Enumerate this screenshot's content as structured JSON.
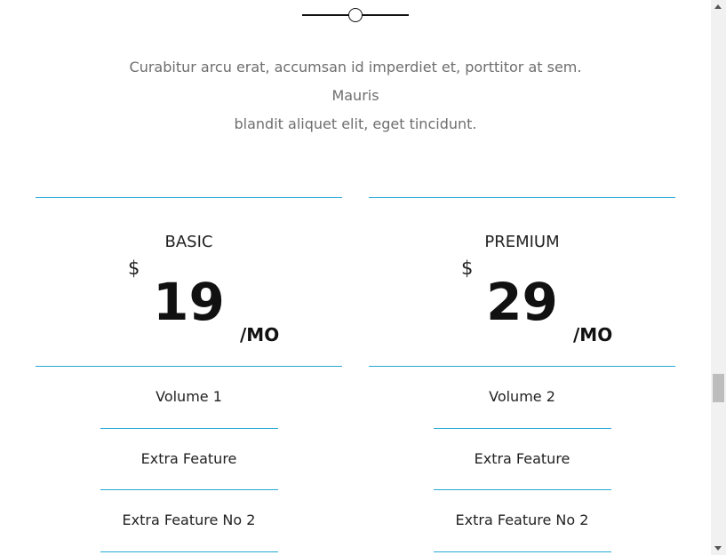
{
  "intro": {
    "line1": "Curabitur arcu erat, accumsan id imperdiet et, porttitor at sem. Mauris",
    "line2": "blandit aliquet elit, eget tincidunt."
  },
  "plans": [
    {
      "name": "BASIC",
      "currency": "$",
      "amount": "19",
      "period": "/MO",
      "features": [
        "Volume 1",
        "Extra Feature",
        "Extra Feature No 2"
      ]
    },
    {
      "name": "PREMIUM",
      "currency": "$",
      "amount": "29",
      "period": "/MO",
      "features": [
        "Volume 2",
        "Extra Feature",
        "Extra Feature No 2"
      ]
    }
  ],
  "colors": {
    "accent_rule": "#27a9d6",
    "text_muted": "#6e6e6e",
    "text_dark": "#111111"
  },
  "icons": {
    "divider": "circle-divider-icon",
    "scroll_up": "arrow-up-icon",
    "scroll_down": "arrow-down-icon"
  }
}
